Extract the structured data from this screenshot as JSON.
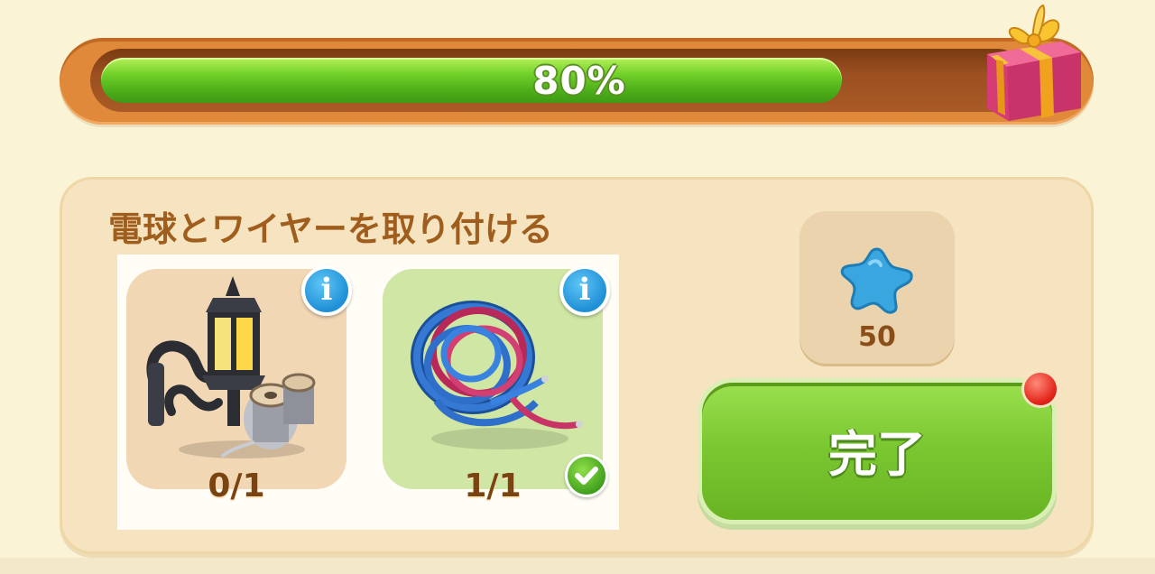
{
  "progress": {
    "value_percent": 80,
    "label": "80%",
    "reward_icon": "gift-box-icon"
  },
  "task": {
    "title": "電球とワイヤーを取り付ける",
    "items": [
      {
        "name": "street-lamp-and-spools",
        "icon": "lamp-icon",
        "count": "0/1",
        "completed": false
      },
      {
        "name": "wire-coil",
        "icon": "wire-icon",
        "count": "1/1",
        "completed": true
      }
    ],
    "reward": {
      "icon": "blue-star-icon",
      "value": "50"
    },
    "complete_button": "完了"
  },
  "colors": {
    "progress_fill": "#6cc526",
    "button_green": "#7cc832",
    "title_brown": "#a05e1e",
    "info_blue": "#1f8fd6",
    "notify_red": "#e3261b"
  }
}
